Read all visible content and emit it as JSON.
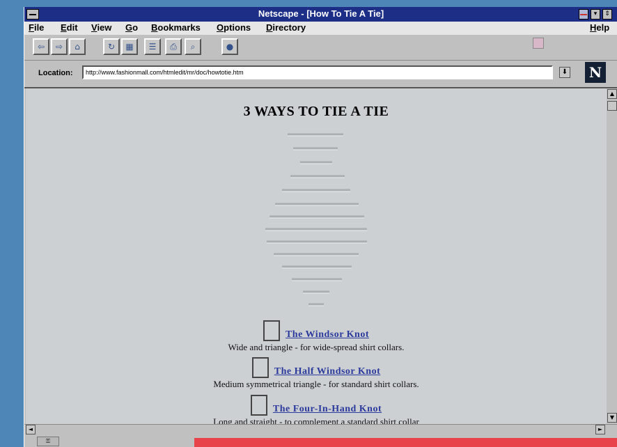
{
  "window": {
    "title": "Netscape - [How To Tie A Tie]"
  },
  "menu": [
    "File",
    "Edit",
    "View",
    "Go",
    "Bookmarks",
    "Options",
    "Directory",
    "Help"
  ],
  "toolbar": {
    "buttons": [
      "back-icon",
      "forward-icon",
      "home-icon",
      "reload-icon",
      "images-icon",
      "open-icon",
      "print-icon",
      "find-icon",
      "stop-icon"
    ]
  },
  "location": {
    "label": "Location:",
    "url": "http://www.fashionmall.com/htmledit/mr/doc/howtotie.htm"
  },
  "logo": "N",
  "page": {
    "heading": "3 WAYS TO TIE A TIE",
    "knots": [
      {
        "title": "The Windsor Knot",
        "description": "Wide and triangle - for wide-spread shirt collars."
      },
      {
        "title": "The Half Windsor Knot",
        "description": "Medium symmetrical triangle - for standard shirt collars."
      },
      {
        "title": "The Four-In-Hand Knot",
        "description": "Long and straight - to complement a standard shirt collar"
      }
    ]
  },
  "colors": {
    "titlebar": "#1c2e86",
    "desktop": "#4f86b8",
    "link": "#2b3a9c",
    "progress": "#e8434a"
  }
}
